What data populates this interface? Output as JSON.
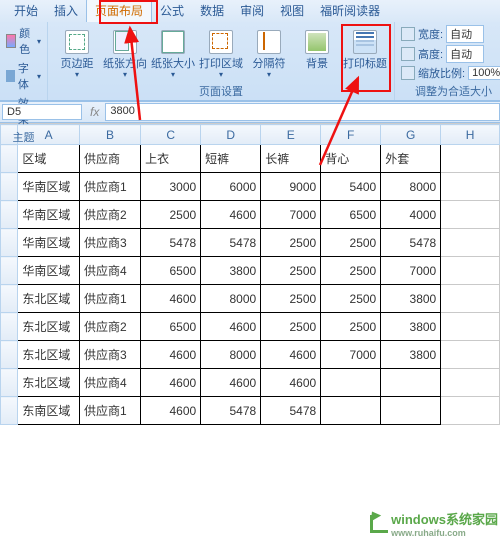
{
  "tabs": [
    "开始",
    "插入",
    "页面布局",
    "公式",
    "数据",
    "审阅",
    "视图",
    "福昕阅读器"
  ],
  "active_tab_index": 2,
  "theme": {
    "color": "颜色",
    "font": "字体",
    "effect": "效果",
    "label": "主题"
  },
  "page_setup": {
    "margins": "页边距",
    "orientation": "纸张方向",
    "size": "纸张大小",
    "print_area": "打印区域",
    "breaks": "分隔符",
    "background": "背景",
    "print_titles": "打印标题",
    "label": "页面设置"
  },
  "scale_fit": {
    "width_label": "宽度:",
    "width_value": "自动",
    "height_label": "高度:",
    "height_value": "自动",
    "scale_label": "缩放比例:",
    "scale_value": "100%",
    "label": "调整为合适大小"
  },
  "namebox": "D5",
  "formula": "3800",
  "columns": [
    "",
    "A",
    "B",
    "C",
    "D",
    "E",
    "F",
    "G",
    "H"
  ],
  "headers": [
    "区域",
    "供应商",
    "上衣",
    "短裤",
    "长裤",
    "背心",
    "外套"
  ],
  "rows": [
    {
      "region": "华南区域",
      "supplier": "供应商1",
      "v": [
        3000,
        6000,
        9000,
        5400,
        8000
      ]
    },
    {
      "region": "华南区域",
      "supplier": "供应商2",
      "v": [
        2500,
        4600,
        7000,
        6500,
        4000
      ]
    },
    {
      "region": "华南区域",
      "supplier": "供应商3",
      "v": [
        5478,
        5478,
        2500,
        2500,
        5478
      ]
    },
    {
      "region": "华南区域",
      "supplier": "供应商4",
      "v": [
        6500,
        3800,
        2500,
        2500,
        7000
      ]
    },
    {
      "region": "东北区域",
      "supplier": "供应商1",
      "v": [
        4600,
        8000,
        2500,
        2500,
        3800
      ]
    },
    {
      "region": "东北区域",
      "supplier": "供应商2",
      "v": [
        6500,
        4600,
        2500,
        2500,
        3800
      ]
    },
    {
      "region": "东北区域",
      "supplier": "供应商3",
      "v": [
        4600,
        8000,
        4600,
        7000,
        3800
      ]
    },
    {
      "region": "东北区域",
      "supplier": "供应商4",
      "v": [
        4600,
        4600,
        4600,
        null,
        null
      ]
    },
    {
      "region": "东南区域",
      "supplier": "供应商1",
      "v": [
        4600,
        5478,
        5478,
        null,
        null
      ]
    }
  ],
  "watermark": "windows系统家园",
  "watermark_sub": "www.ruhaifu.com"
}
